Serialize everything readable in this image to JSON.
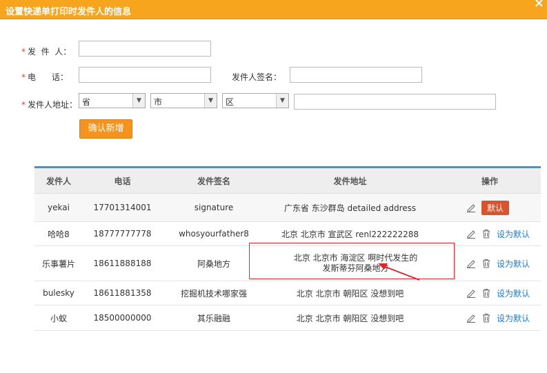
{
  "dialog": {
    "title": "设置快递单打印时发件人的信息",
    "close_glyph": "×"
  },
  "form": {
    "required_mark": "*",
    "sender_label": "发  件  人：",
    "phone_label": "电      话：",
    "signature_label": "发件人签名：",
    "address_label": "发件人地址：",
    "sender_value": "",
    "phone_value": "",
    "signature_value": "",
    "detail_value": "",
    "province": "省",
    "city": "市",
    "district": "区",
    "add_button": "确认新增"
  },
  "table": {
    "headers": [
      "发件人",
      "电话",
      "发件签名",
      "发件地址",
      "操作"
    ],
    "rows": [
      {
        "sender": "yekai",
        "phone": "17701314001",
        "signature": "signature",
        "address": "广东省 东沙群岛 detailed address",
        "is_default": true,
        "action": "默认"
      },
      {
        "sender": "哈哈8",
        "phone": "18777777778",
        "signature": "whosyourfather8",
        "address": "北京 北京市 宣武区 renl222222288",
        "is_default": false,
        "action": "设为默认"
      },
      {
        "sender": "乐事薯片",
        "phone": "18611888188",
        "signature": "阿桑地方",
        "address": "北京 北京市 海淀区 啊时代发生的发斯蒂芬阿桑地方",
        "is_default": false,
        "action": "设为默认"
      },
      {
        "sender": "bulesky",
        "phone": "18611881358",
        "signature": "挖掘机技术哪家强",
        "address": "北京 北京市 朝阳区 没想到吧",
        "is_default": false,
        "action": "设为默认"
      },
      {
        "sender": "小蚁",
        "phone": "18500000000",
        "signature": "其乐融融",
        "address": "北京 北京市 朝阳区 没想到吧",
        "is_default": false,
        "action": "设为默认"
      }
    ]
  },
  "colors": {
    "title_bar": "#f7a51c",
    "add_button": "#f6931d",
    "table_accent": "#2f9bd7",
    "default_badge": "#d9532c",
    "link": "#1a7bd4",
    "annotation": "#e0262d"
  }
}
